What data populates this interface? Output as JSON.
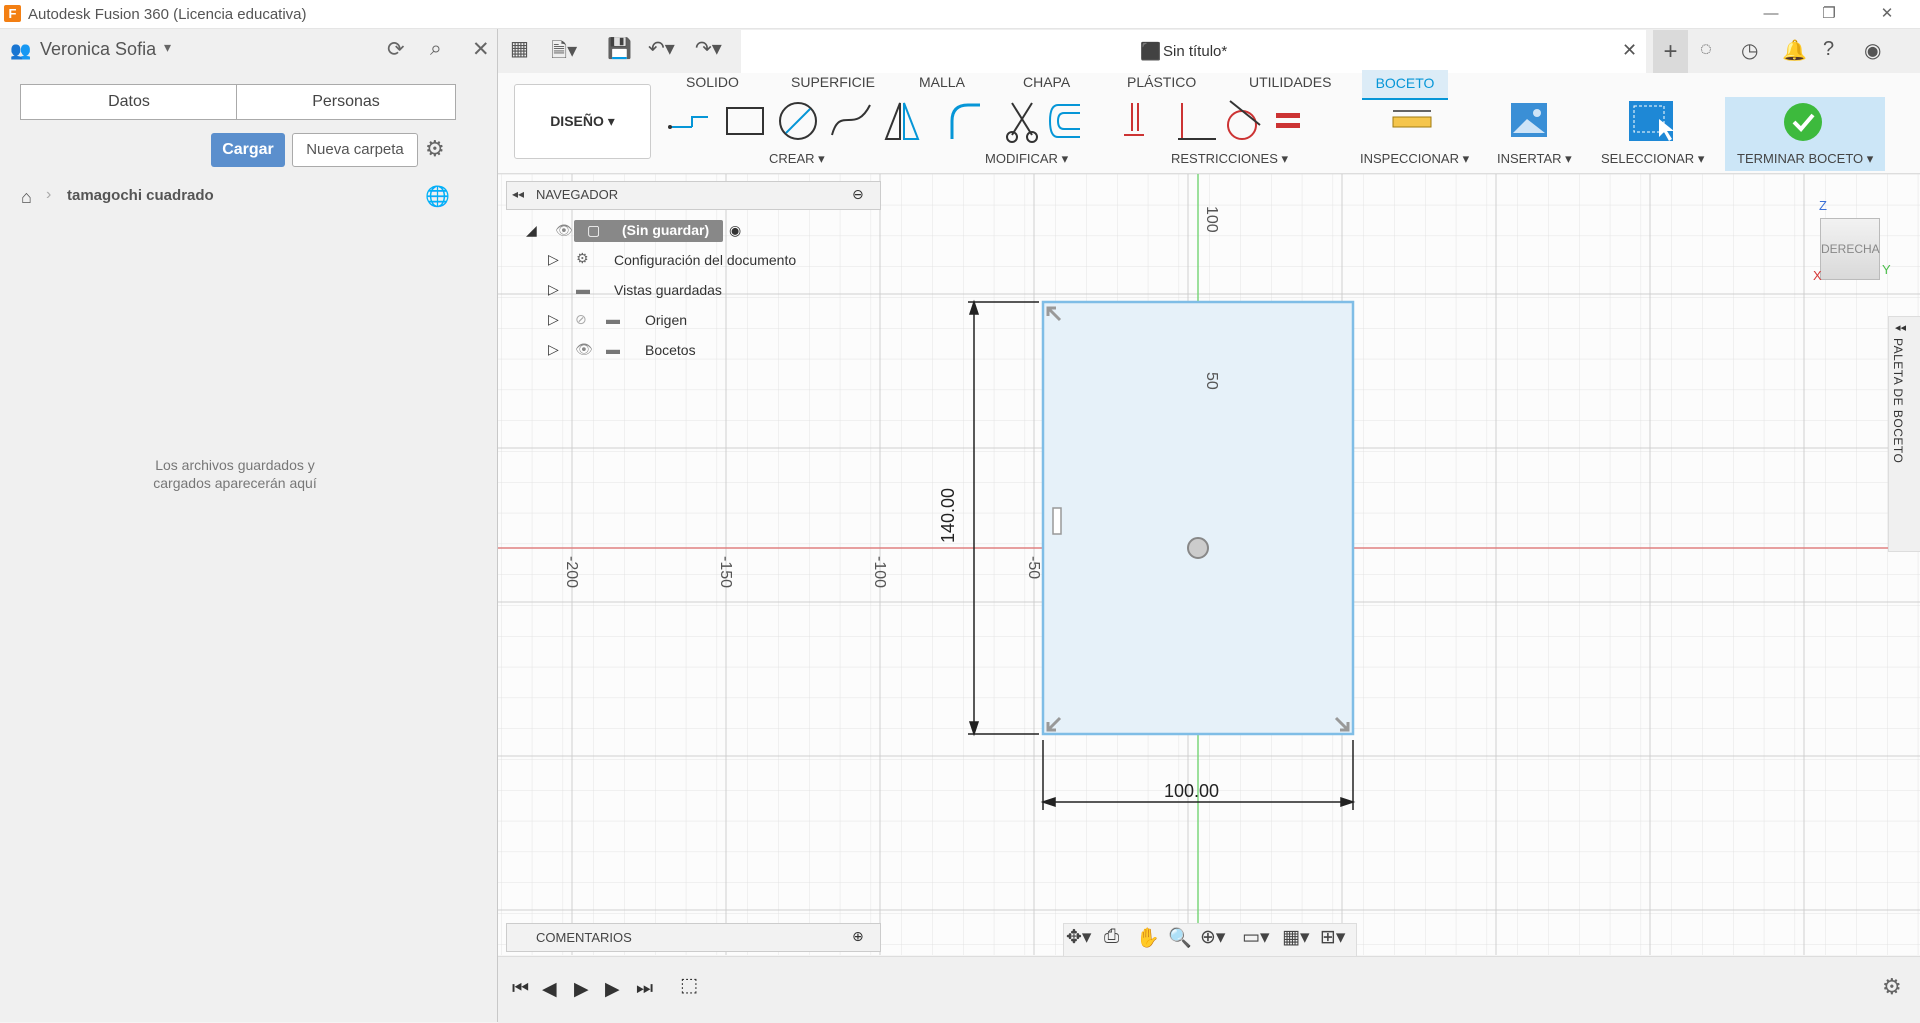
{
  "window": {
    "title": "Autodesk Fusion 360 (Licencia educativa)",
    "logo_letter": "F",
    "controls": [
      "—",
      "❐",
      "✕"
    ]
  },
  "data_panel": {
    "user_name": "Veronica Sofia",
    "tabs": [
      "Datos",
      "Personas"
    ],
    "upload_label": "Cargar",
    "new_folder_label": "Nueva carpeta",
    "breadcrumb": "tamagochi cuadrado",
    "empty_message_line1": "Los archivos guardados y",
    "empty_message_line2": "cargados aparecerán aquí"
  },
  "document": {
    "title": "Sin título*"
  },
  "ribbon": {
    "workspace": "DISEÑO",
    "tabs": [
      "SOLIDO",
      "SUPERFICIE",
      "MALLA",
      "CHAPA",
      "PLÁSTICO",
      "UTILIDADES",
      "BOCETO"
    ],
    "active_tab": "BOCETO",
    "groups": [
      "CREAR",
      "MODIFICAR",
      "RESTRICCIONES",
      "INSPECCIONAR",
      "INSERTAR",
      "SELECCIONAR",
      "TERMINAR BOCETO"
    ]
  },
  "navigator": {
    "title": "NAVEGADOR",
    "root": "(Sin guardar)",
    "items": [
      "Configuración del documento",
      "Vistas guardadas",
      "Origen",
      "Bocetos"
    ]
  },
  "comments": {
    "title": "COMENTARIOS"
  },
  "viewcube": {
    "face": "DERECHA",
    "axis_z": "Z",
    "axis_y": "Y",
    "axis_x": "X"
  },
  "palette": {
    "label": "PALETA DE BOCETO"
  },
  "sketch": {
    "width_dimension": "100.00",
    "height_dimension": "140.00",
    "axis_labels_horizontal": [
      "-200",
      "-150",
      "-100",
      "-50"
    ],
    "axis_labels_vertical": [
      "100",
      "50"
    ]
  },
  "colors": {
    "accent": "#0696d7",
    "sketch_fill": "#e6f1f9",
    "sketch_line": "#7fbde6",
    "x_axis": "#e08080",
    "y_axis": "#7cd67c",
    "finish_green": "#3dba3d"
  }
}
